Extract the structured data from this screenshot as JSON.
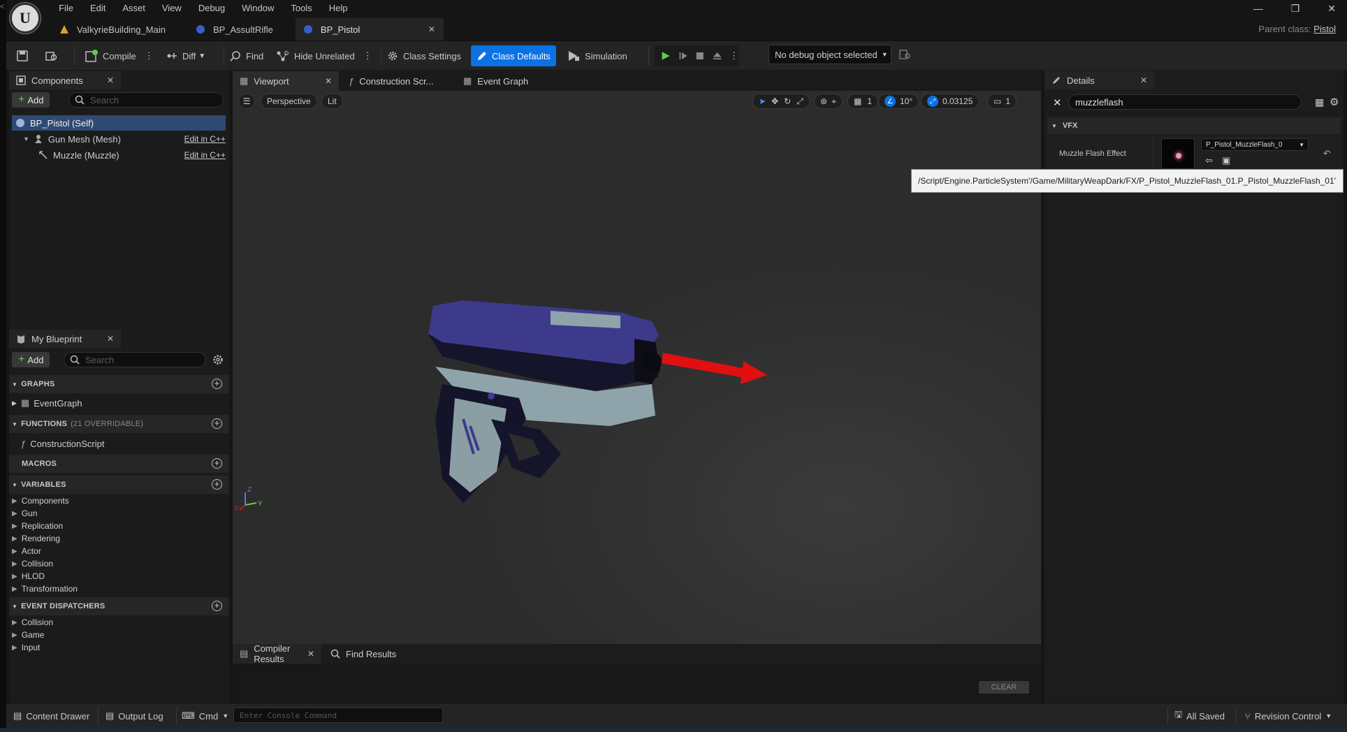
{
  "left_strip": {
    "marker": "<"
  },
  "menu": [
    "File",
    "Edit",
    "Asset",
    "View",
    "Debug",
    "Window",
    "Tools",
    "Help"
  ],
  "doc_tabs": [
    {
      "label": "ValkyrieBuilding_Main",
      "icon": "level-icon",
      "active": false
    },
    {
      "label": "BP_AssultRifle",
      "icon": "blueprint-icon",
      "active": false
    },
    {
      "label": "BP_Pistol",
      "icon": "blueprint-icon",
      "active": true
    }
  ],
  "window_controls": {
    "minimize": "—",
    "restore": "❐",
    "close": "✕"
  },
  "parent_class": {
    "label": "Parent class:",
    "value": "Pistol"
  },
  "toolbar": {
    "compile": "Compile",
    "diff": "Diff",
    "find": "Find",
    "hide_unrelated": "Hide Unrelated",
    "class_settings": "Class Settings",
    "class_defaults": "Class Defaults",
    "simulation": "Simulation",
    "debug_object": "No debug object selected"
  },
  "components": {
    "tab": "Components",
    "add": "Add",
    "search_placeholder": "Search",
    "items": [
      {
        "label": "BP_Pistol (Self)",
        "link": ""
      },
      {
        "label": "Gun Mesh (Mesh)",
        "link": "Edit in C++"
      },
      {
        "label": "Muzzle (Muzzle)",
        "link": "Edit in C++"
      }
    ]
  },
  "my_blueprint": {
    "tab": "My Blueprint",
    "add": "Add",
    "search_placeholder": "Search",
    "graphs": {
      "title": "GRAPHS",
      "items": [
        "EventGraph"
      ]
    },
    "functions": {
      "title": "FUNCTIONS",
      "note": "(21 OVERRIDABLE)",
      "items": [
        "ConstructionScript"
      ]
    },
    "macros": {
      "title": "MACROS"
    },
    "variables": {
      "title": "VARIABLES",
      "items": [
        "Components",
        "Gun",
        "Replication",
        "Rendering",
        "Actor",
        "Collision",
        "HLOD",
        "Transformation"
      ]
    },
    "dispatchers": {
      "title": "EVENT DISPATCHERS",
      "items": [
        "Collision",
        "Game",
        "Input"
      ]
    }
  },
  "editor_tabs": [
    "Viewport",
    "Construction Scr...",
    "Event Graph"
  ],
  "viewport": {
    "perspective": "Perspective",
    "lit": "Lit",
    "grid_value": "1",
    "angle_value": "10°",
    "scale_value": "0.03125",
    "camera_value": "1",
    "axis": {
      "z": "Z",
      "x": "X",
      "y": "Y"
    }
  },
  "bottom_tabs": {
    "compiler": "Compiler Results",
    "find": "Find Results",
    "clear": "CLEAR"
  },
  "details": {
    "tab": "Details",
    "search_value": "muzzleflash",
    "category": "VFX",
    "property": "Muzzle Flash Effect",
    "asset": "P_Pistol_MuzzleFlash_0"
  },
  "tooltip": "/Script/Engine.ParticleSystem'/Game/MilitaryWeapDark/FX/P_Pistol_MuzzleFlash_01.P_Pistol_MuzzleFlash_01'",
  "status": {
    "content_drawer": "Content Drawer",
    "output_log": "Output Log",
    "cmd": "Cmd",
    "console_placeholder": "Enter Console Command",
    "all_saved": "All Saved",
    "revision_control": "Revision Control"
  },
  "colors": {
    "accent": "#0a72e4",
    "play": "#5fcc4f",
    "arrow": "#e01010",
    "panel": "#1c1c1c",
    "toolbar": "#242424"
  }
}
